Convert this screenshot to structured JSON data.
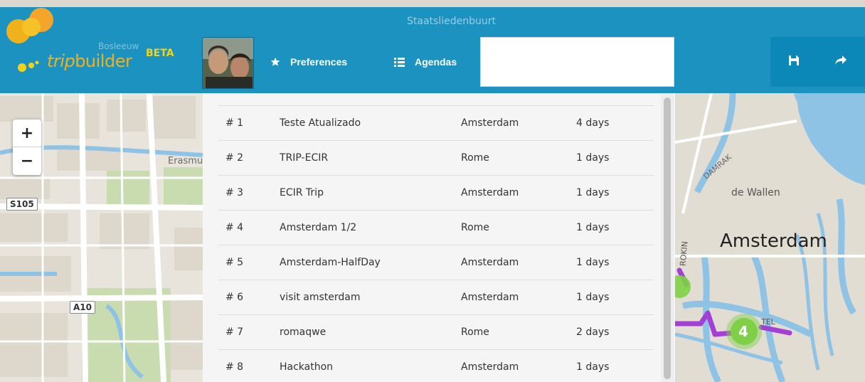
{
  "app": {
    "brand_name": "tripbuilder",
    "brand_badge": "BETA"
  },
  "nav": {
    "preferences_label": "Preferences",
    "agendas_label": "Agendas",
    "search_value": ""
  },
  "toolbar": {
    "save_icon": "save-icon",
    "share_icon": "share-arrow-icon"
  },
  "zoom": {
    "in_label": "+",
    "out_label": "−"
  },
  "agendas": [
    {
      "num": "# 1",
      "title": "Teste Atualizado",
      "city": "Amsterdam",
      "days": "4 days"
    },
    {
      "num": "# 2",
      "title": "TRIP-ECIR",
      "city": "Rome",
      "days": "1 days"
    },
    {
      "num": "# 3",
      "title": "ECIR Trip",
      "city": "Amsterdam",
      "days": "1 days"
    },
    {
      "num": "# 4",
      "title": "Amsterdam 1/2",
      "city": "Rome",
      "days": "1 days"
    },
    {
      "num": "# 5",
      "title": "Amsterdam-HalfDay",
      "city": "Amsterdam",
      "days": "1 days"
    },
    {
      "num": "# 6",
      "title": "visit amsterdam",
      "city": "Amsterdam",
      "days": "1 days"
    },
    {
      "num": "# 7",
      "title": "romaqwe",
      "city": "Rome",
      "days": "2 days"
    },
    {
      "num": "# 8",
      "title": "Hackathon",
      "city": "Amsterdam",
      "days": "1 days"
    }
  ],
  "map": {
    "labels": {
      "staatsliedenbuurt": "Staatsliedenbuurt",
      "bosleeuw": "Bosleeuw",
      "erasmus": "Erasmu",
      "s105": "S105",
      "a10": "A10",
      "damrak": "DAMRAK",
      "de_wallen": "de Wallen",
      "amsterdam": "Amsterdam",
      "rokin": "ROKIN",
      "tel": "TEL"
    },
    "cluster_count": "4",
    "colors": {
      "header": "#0c8cbe",
      "water": "#8ec3e6",
      "park": "#c9dcb1",
      "route": "#a43fd6",
      "cluster": "#7ed046",
      "logo": "#f0b21c"
    }
  }
}
